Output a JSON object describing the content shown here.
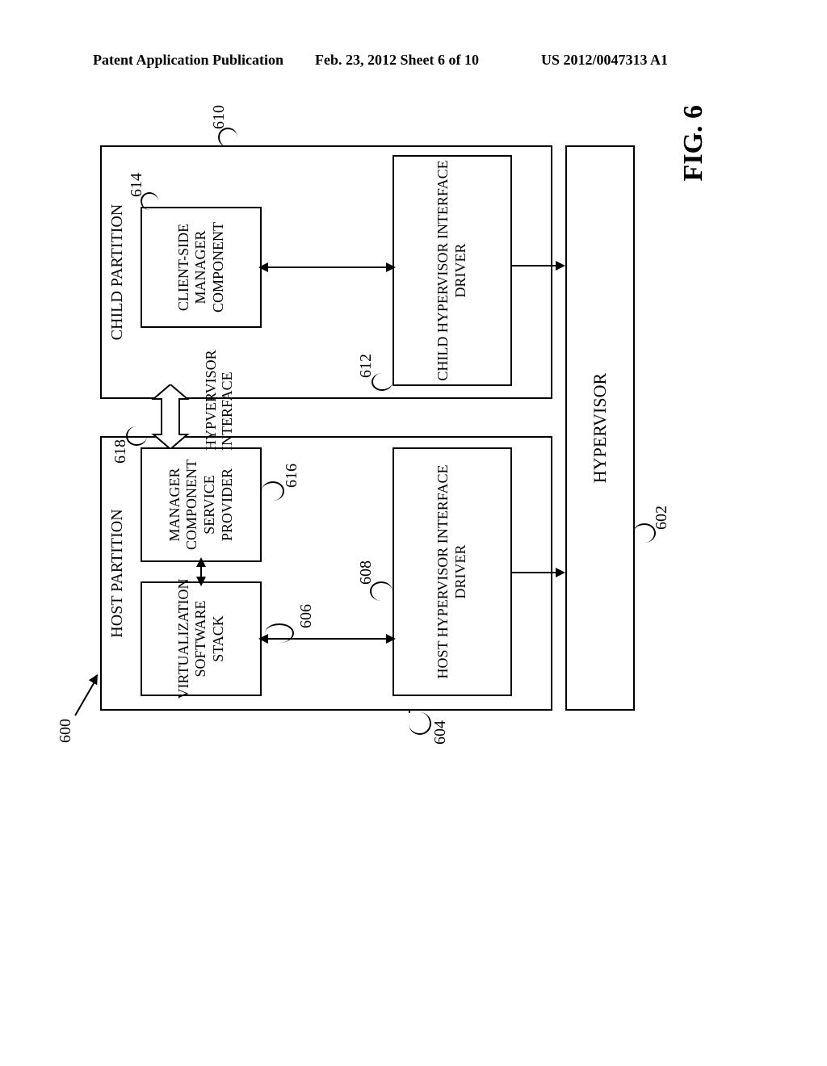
{
  "header": {
    "left": "Patent Application Publication",
    "center": "Feb. 23, 2012  Sheet 6 of 10",
    "right": "US 2012/0047313 A1"
  },
  "figure": {
    "caption": "FIG. 6",
    "host_partition_title": "HOST PARTITION",
    "child_partition_title": "CHILD PARTITION",
    "hypervisor": "HYPERVISOR",
    "virtualization_stack": "VIRTUALIZATION SOFTWARE STACK",
    "manager_provider": "MANAGER COMPONENT SERVICE PROVIDER",
    "host_hid": "HOST HYPERVISOR INTERFACE DRIVER",
    "client_manager": "CLIENT-SIDE MANAGER COMPONENT",
    "child_hid": "CHILD HYPERVISOR INTERFACE DRIVER",
    "hypervisor_interface": "HYPVERVISOR INTERFACE"
  },
  "refs": {
    "r600": "600",
    "r602": "602",
    "r604": "604",
    "r606": "606",
    "r608": "608",
    "r610": "610",
    "r612": "612",
    "r614": "614",
    "r616": "616",
    "r618": "618"
  }
}
